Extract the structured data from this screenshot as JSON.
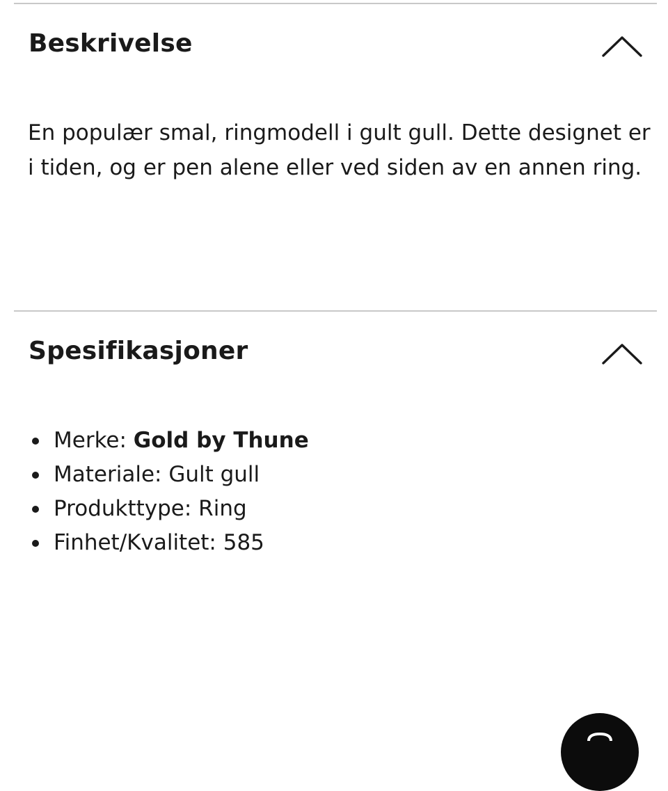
{
  "description_section": {
    "title": "Beskrivelse",
    "expanded": true,
    "toggle_icon": "chevron-up-icon",
    "body": "En populær smal, ringmodell i gult gull. Dette designet er i tiden, og er pen alene eller ved siden av en annen ring."
  },
  "specifications_section": {
    "title": "Spesifikasjoner",
    "expanded": true,
    "toggle_icon": "chevron-up-icon",
    "items": [
      {
        "label": "Merke: ",
        "value": "Gold by Thune",
        "value_bold": true
      },
      {
        "label": "Materiale: ",
        "value": "Gult gull",
        "value_bold": false
      },
      {
        "label": "Produkttype: ",
        "value": "Ring",
        "value_bold": false
      },
      {
        "label": "Finhet/Kvalitet: ",
        "value": "585",
        "value_bold": false
      }
    ]
  },
  "chat_button": {
    "icon": "chat-icon",
    "color": "#0c0c0c"
  },
  "colors": {
    "text": "#1a1a1a",
    "divider": "#c8c8c8",
    "background": "#ffffff"
  }
}
